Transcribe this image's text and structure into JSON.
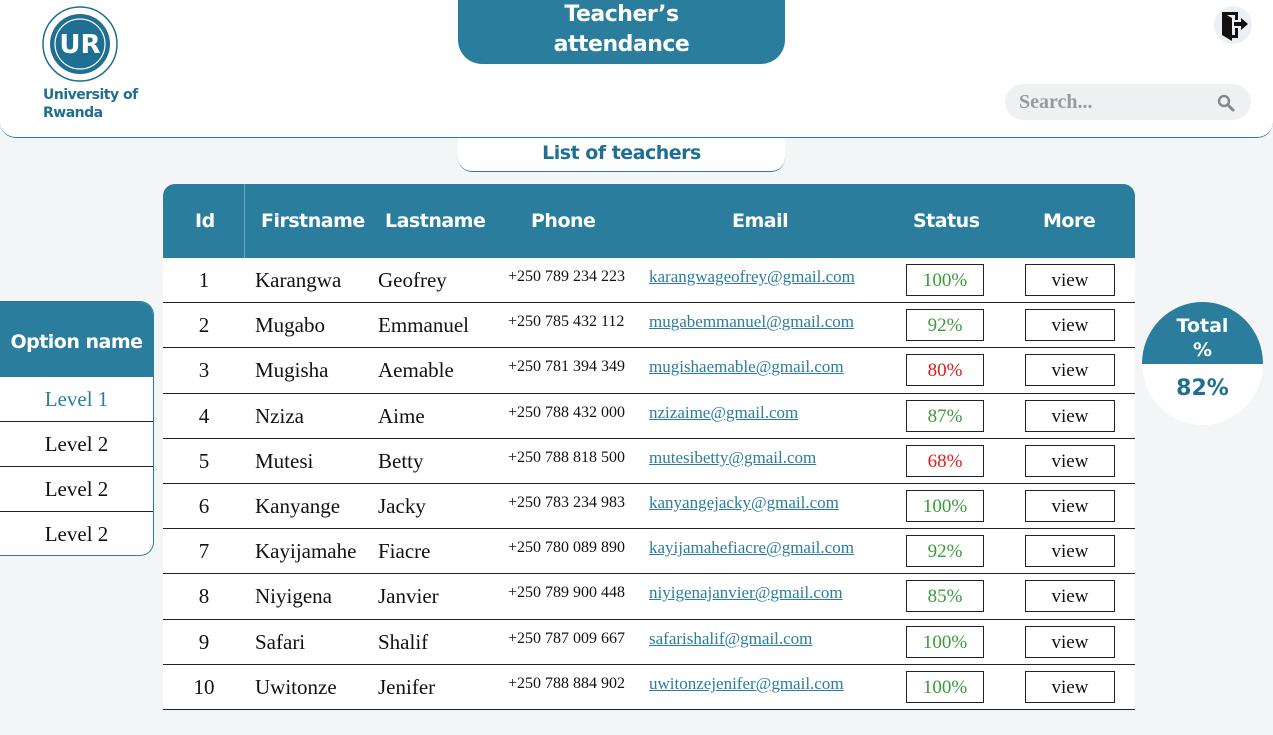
{
  "header": {
    "university_line1": "University of",
    "university_line2": "Rwanda",
    "logo_text": "UR",
    "title_line1": "Teacher’s",
    "title_line2": "attendance"
  },
  "search": {
    "placeholder": "Search..."
  },
  "list_label": "List of teachers",
  "sidebar": {
    "header": "Option name",
    "items": [
      {
        "label": "Level 1",
        "active": true
      },
      {
        "label": "Level 2",
        "active": false
      },
      {
        "label": "Level 2",
        "active": false
      },
      {
        "label": "Level 2",
        "active": false
      }
    ]
  },
  "table": {
    "columns": [
      "Id",
      "Firstname",
      "Lastname",
      "Phone",
      "Email",
      "Status",
      "More"
    ],
    "view_label": "view",
    "rows": [
      {
        "id": "1",
        "first": "Karangwa",
        "last": "Geofrey",
        "phone": "+250 789 234 223",
        "email": "karangwageofrey@gmail.com",
        "status": "100%",
        "status_level": "good"
      },
      {
        "id": "2",
        "first": "Mugabo",
        "last": "Emmanuel",
        "phone": "+250 785 432 112",
        "email": "mugabemmanuel@gmail.com",
        "status": "92%",
        "status_level": "good"
      },
      {
        "id": "3",
        "first": "Mugisha",
        "last": "Aemable",
        "phone": "+250 781 394 349",
        "email": "mugishaemable@gmail.com",
        "status": "80%",
        "status_level": "bad"
      },
      {
        "id": "4",
        "first": "Nziza",
        "last": "Aime",
        "phone": "+250 788 432 000",
        "email": "nzizaime@gmail.com",
        "status": "87%",
        "status_level": "good"
      },
      {
        "id": "5",
        "first": "Mutesi",
        "last": "Betty",
        "phone": "+250 788 818 500",
        "email": "mutesibetty@gmail.com",
        "status": "68%",
        "status_level": "bad"
      },
      {
        "id": "6",
        "first": "Kanyange",
        "last": "Jacky",
        "phone": "+250 783 234 983",
        "email": "kanyangejacky@gmail.com",
        "status": "100%",
        "status_level": "good"
      },
      {
        "id": "7",
        "first": "Kayijamahe",
        "last": "Fiacre",
        "phone": "+250 780 089 890",
        "email": "kayijamahefiacre@gmail.com",
        "status": "92%",
        "status_level": "good"
      },
      {
        "id": "8",
        "first": "Niyigena",
        "last": "Janvier",
        "phone": "+250 789 900 448",
        "email": "niyigenajanvier@gmail.com",
        "status": "85%",
        "status_level": "good"
      },
      {
        "id": "9",
        "first": "Safari",
        "last": "Shalif",
        "phone": "+250 787 009 667",
        "email": "safarishalif@gmail.com",
        "status": "100%",
        "status_level": "good"
      },
      {
        "id": "10",
        "first": "Uwitonze",
        "last": "Jenifer",
        "phone": "+250 788 884 902",
        "email": "uwitonzejenifer@gmail.com",
        "status": "100%",
        "status_level": "good"
      }
    ]
  },
  "total": {
    "label_line1": "Total",
    "label_line2": "%",
    "value": "82%"
  },
  "colors": {
    "accent": "#2a7d9c",
    "status_good": "#3b9a3b",
    "status_bad": "#e01b1b"
  },
  "icons": {
    "logout": "logout-icon",
    "search": "search-icon",
    "logo": "university-logo"
  }
}
